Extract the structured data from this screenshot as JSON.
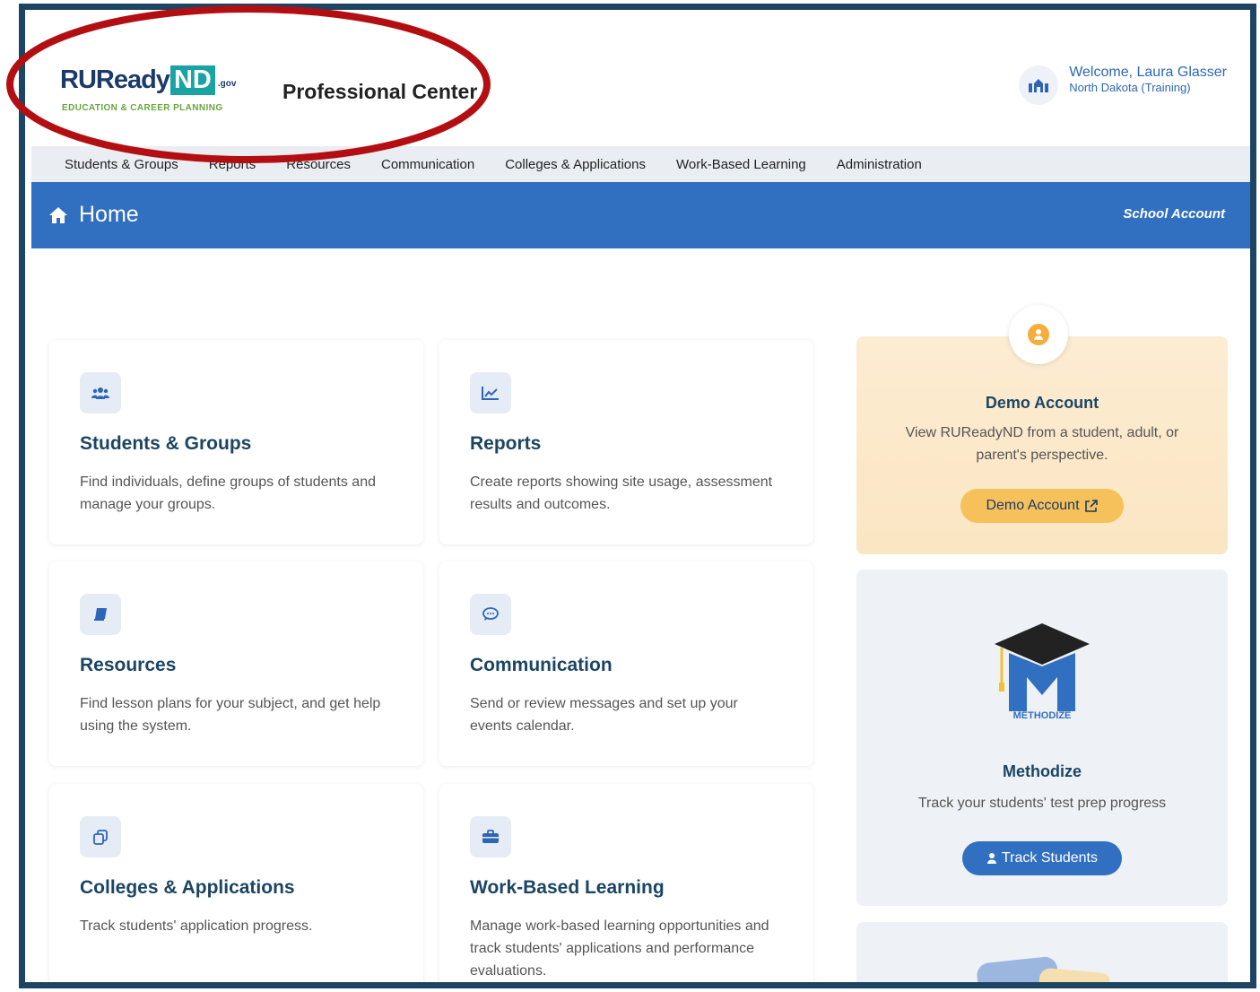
{
  "header": {
    "logo_main": "RUReady",
    "logo_nd": "ND",
    "logo_gov": ".gov",
    "logo_sub": "EDUCATION & CAREER PLANNING",
    "app_title": "Professional Center",
    "welcome": "Welcome, Laura Glasser",
    "state": "North Dakota (Training)"
  },
  "nav": {
    "items": [
      "Students & Groups",
      "Reports",
      "Resources",
      "Communication",
      "Colleges & Applications",
      "Work-Based Learning",
      "Administration"
    ]
  },
  "homebar": {
    "title": "Home",
    "account_type": "School Account"
  },
  "cards": [
    {
      "title": "Students & Groups",
      "desc": "Find individuals, define groups of students and manage your groups.",
      "icon": "users-icon"
    },
    {
      "title": "Reports",
      "desc": "Create reports showing site usage, assessment results and outcomes.",
      "icon": "chart-line-icon"
    },
    {
      "title": "Resources",
      "desc": "Find lesson plans for your subject, and get help using the system.",
      "icon": "book-icon"
    },
    {
      "title": "Communication",
      "desc": "Send or review messages and set up your events calendar.",
      "icon": "chat-icon"
    },
    {
      "title": "Colleges & Applications",
      "desc": "Track students' application progress.",
      "icon": "copy-icon"
    },
    {
      "title": "Work-Based Learning",
      "desc": "Manage work-based learning opportunities and track students' applications and performance evaluations.",
      "icon": "briefcase-icon"
    }
  ],
  "demo": {
    "title": "Demo Account",
    "desc": "View RUReadyND from a student, adult, or parent's perspective.",
    "button": "Demo Account"
  },
  "methodize": {
    "logo_text": "METHODIZE",
    "title": "Methodize",
    "desc": "Track your students' test prep progress",
    "button": "Track Students"
  },
  "colors": {
    "primary": "#316fc1",
    "navy": "#1c4563",
    "demo_bg": "#fcecd2",
    "annotation": "#b30f12"
  }
}
